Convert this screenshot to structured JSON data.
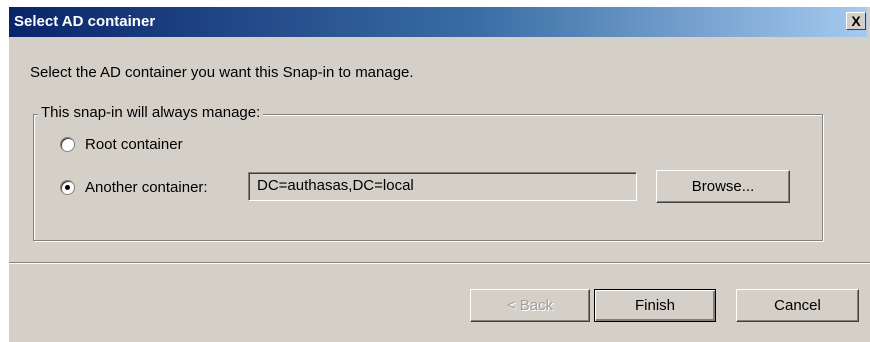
{
  "dialog": {
    "title": "Select AD container",
    "close_glyph": "X",
    "instruction": "Select the AD container you want this Snap-in to manage.",
    "group": {
      "legend": "This snap-in will always manage:",
      "options": [
        {
          "label": "Root container",
          "checked": false
        },
        {
          "label": "Another container:",
          "checked": true
        }
      ],
      "container_value": "DC=authasas,DC=local",
      "browse_label": "Browse..."
    },
    "buttons": {
      "back": "< Back",
      "finish": "Finish",
      "cancel": "Cancel"
    }
  }
}
